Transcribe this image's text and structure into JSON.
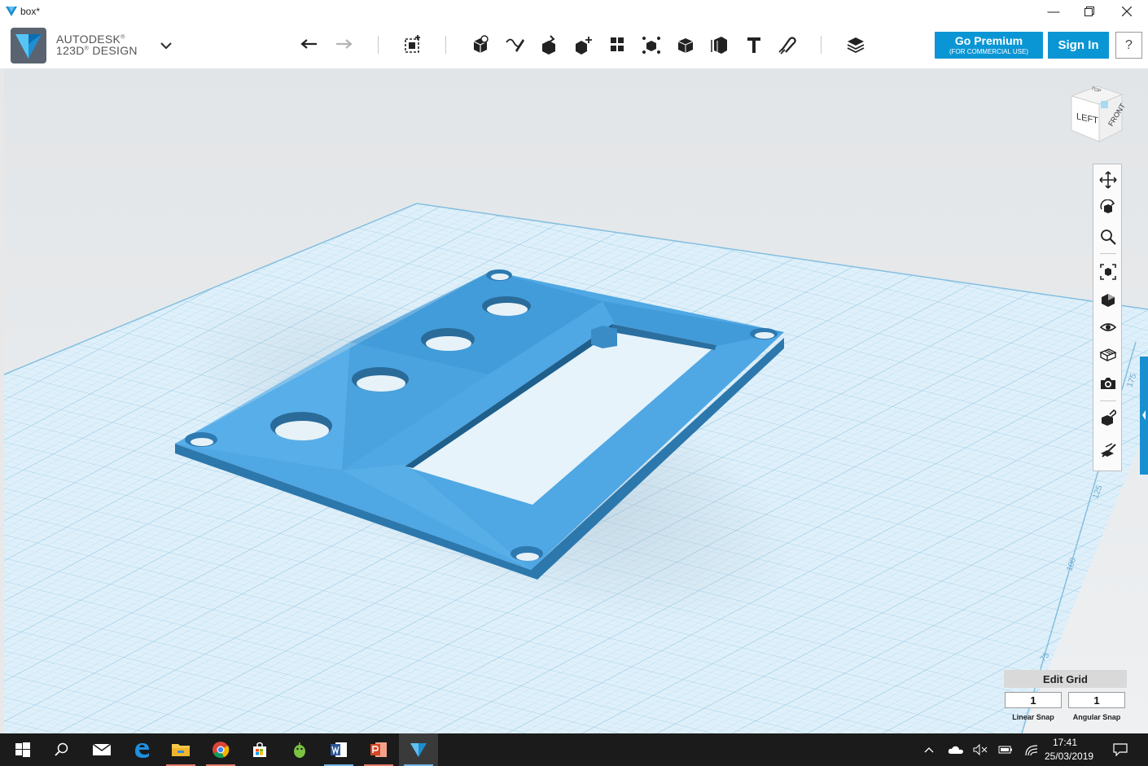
{
  "window": {
    "title": "box*"
  },
  "app": {
    "brand_line1": "AUTODESK",
    "brand_reg1": "®",
    "brand_line2": "123D",
    "brand_reg2": "®",
    "brand_line2b": " DESIGN",
    "logo_icon": "autodesk-123d-logo"
  },
  "toolbar": {
    "undo": "undo-icon",
    "redo": "redo-icon",
    "tools": [
      "new-box-icon",
      "primitives-icon",
      "sketch-icon",
      "construct-icon",
      "modify-icon",
      "pattern-icon",
      "group-icon",
      "combine-icon",
      "measure-icon",
      "text-icon",
      "snap-icon",
      "materials-icon"
    ],
    "premium_label": "Go Premium",
    "premium_sub": "(FOR COMMERCIAL USE)",
    "signin_label": "Sign In",
    "help_label": "?"
  },
  "viewcube": {
    "left": "LEFT",
    "front": "FRONT",
    "top": "TOP"
  },
  "navbar": [
    "pan-icon",
    "orbit-icon",
    "zoom-icon",
    "fit-icon",
    "views-icon",
    "visibility-icon",
    "materials-grid-icon",
    "screenshot-icon",
    "snap-icon",
    "hide-icon"
  ],
  "grid_labels": {
    "r175": "175",
    "r125": "125",
    "r100": "100",
    "r75": "75"
  },
  "edit_grid": {
    "title": "Edit Grid",
    "linear_value": "1",
    "angular_value": "1",
    "linear_label": "Linear Snap",
    "angular_label": "Angular Snap"
  },
  "taskbar": {
    "time": "17:41",
    "date": "25/03/2019",
    "apps": [
      "start-icon",
      "search-icon",
      "mail-icon",
      "edge-icon",
      "explorer-icon",
      "chrome-icon",
      "store-icon",
      "android-icon",
      "word-icon",
      "powerpoint-icon",
      "123d-icon"
    ]
  },
  "colors": {
    "accent": "#0a96d4",
    "model": "#4aa3e0",
    "grid": "#c8e3f2",
    "taskbar": "#1b1b1b"
  }
}
